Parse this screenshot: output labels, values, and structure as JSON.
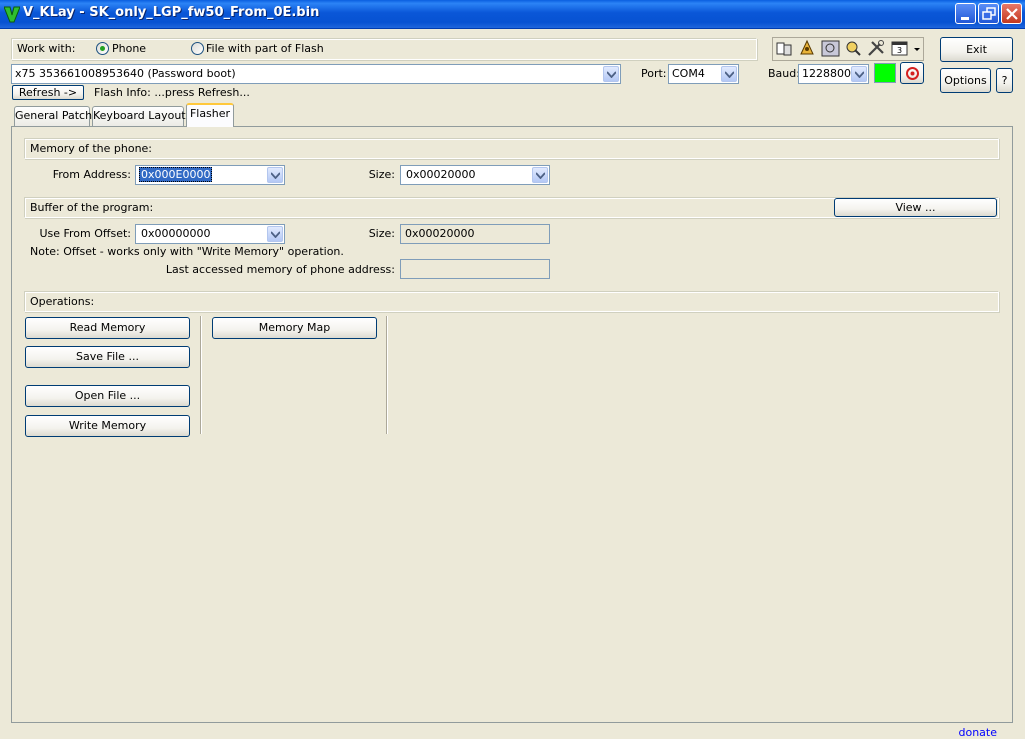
{
  "window": {
    "title": "V_KLay - SK_only_LGP_fw50_From_0E.bin",
    "icon": "v-logo-icon"
  },
  "top": {
    "work_with_label": "Work with:",
    "radio_phone": "Phone",
    "radio_file": "File with part of Flash",
    "selected": "Phone",
    "device_value": "x75 353661008953640 (Password boot)",
    "port_label": "Port:",
    "port_value": "COM4",
    "baud_label": "Baud:",
    "baud_value": "1228800",
    "refresh_button": "Refresh ->",
    "flash_info": "Flash Info: ...press Refresh...",
    "exit_button": "Exit",
    "options_button": "Options",
    "help_button": "?",
    "status_color": "#00ff00",
    "toolbar_icons": [
      "books-icon",
      "bell-icon",
      "id-card-icon",
      "phone-search-icon",
      "tools-icon",
      "window-icon",
      "dropdown-arrow-icon"
    ]
  },
  "tabs": [
    {
      "label": "General Patch",
      "active": false
    },
    {
      "label": "Keyboard Layout",
      "active": false
    },
    {
      "label": "Flasher",
      "active": true
    }
  ],
  "flasher": {
    "memory_header": "Memory of the phone:",
    "from_address_label": "From Address:",
    "from_address_value": "0x000E0000",
    "size_label": "Size:",
    "size_value": "0x00020000",
    "buffer_header": "Buffer of the program:",
    "view_button": "View ...",
    "use_offset_label": "Use From Offset:",
    "use_offset_value": "0x00000000",
    "buffer_size_label": "Size:",
    "buffer_size_value": "0x00020000",
    "note": "Note: Offset - works only with \"Write Memory\" operation.",
    "last_accessed_label": "Last accessed memory of phone address:",
    "last_accessed_value": "",
    "operations_header": "Operations:",
    "read_memory": "Read Memory",
    "save_file": "Save File ...",
    "open_file": "Open File ...",
    "write_memory": "Write Memory",
    "memory_map": "Memory Map"
  },
  "status": {
    "donate": "donate"
  }
}
